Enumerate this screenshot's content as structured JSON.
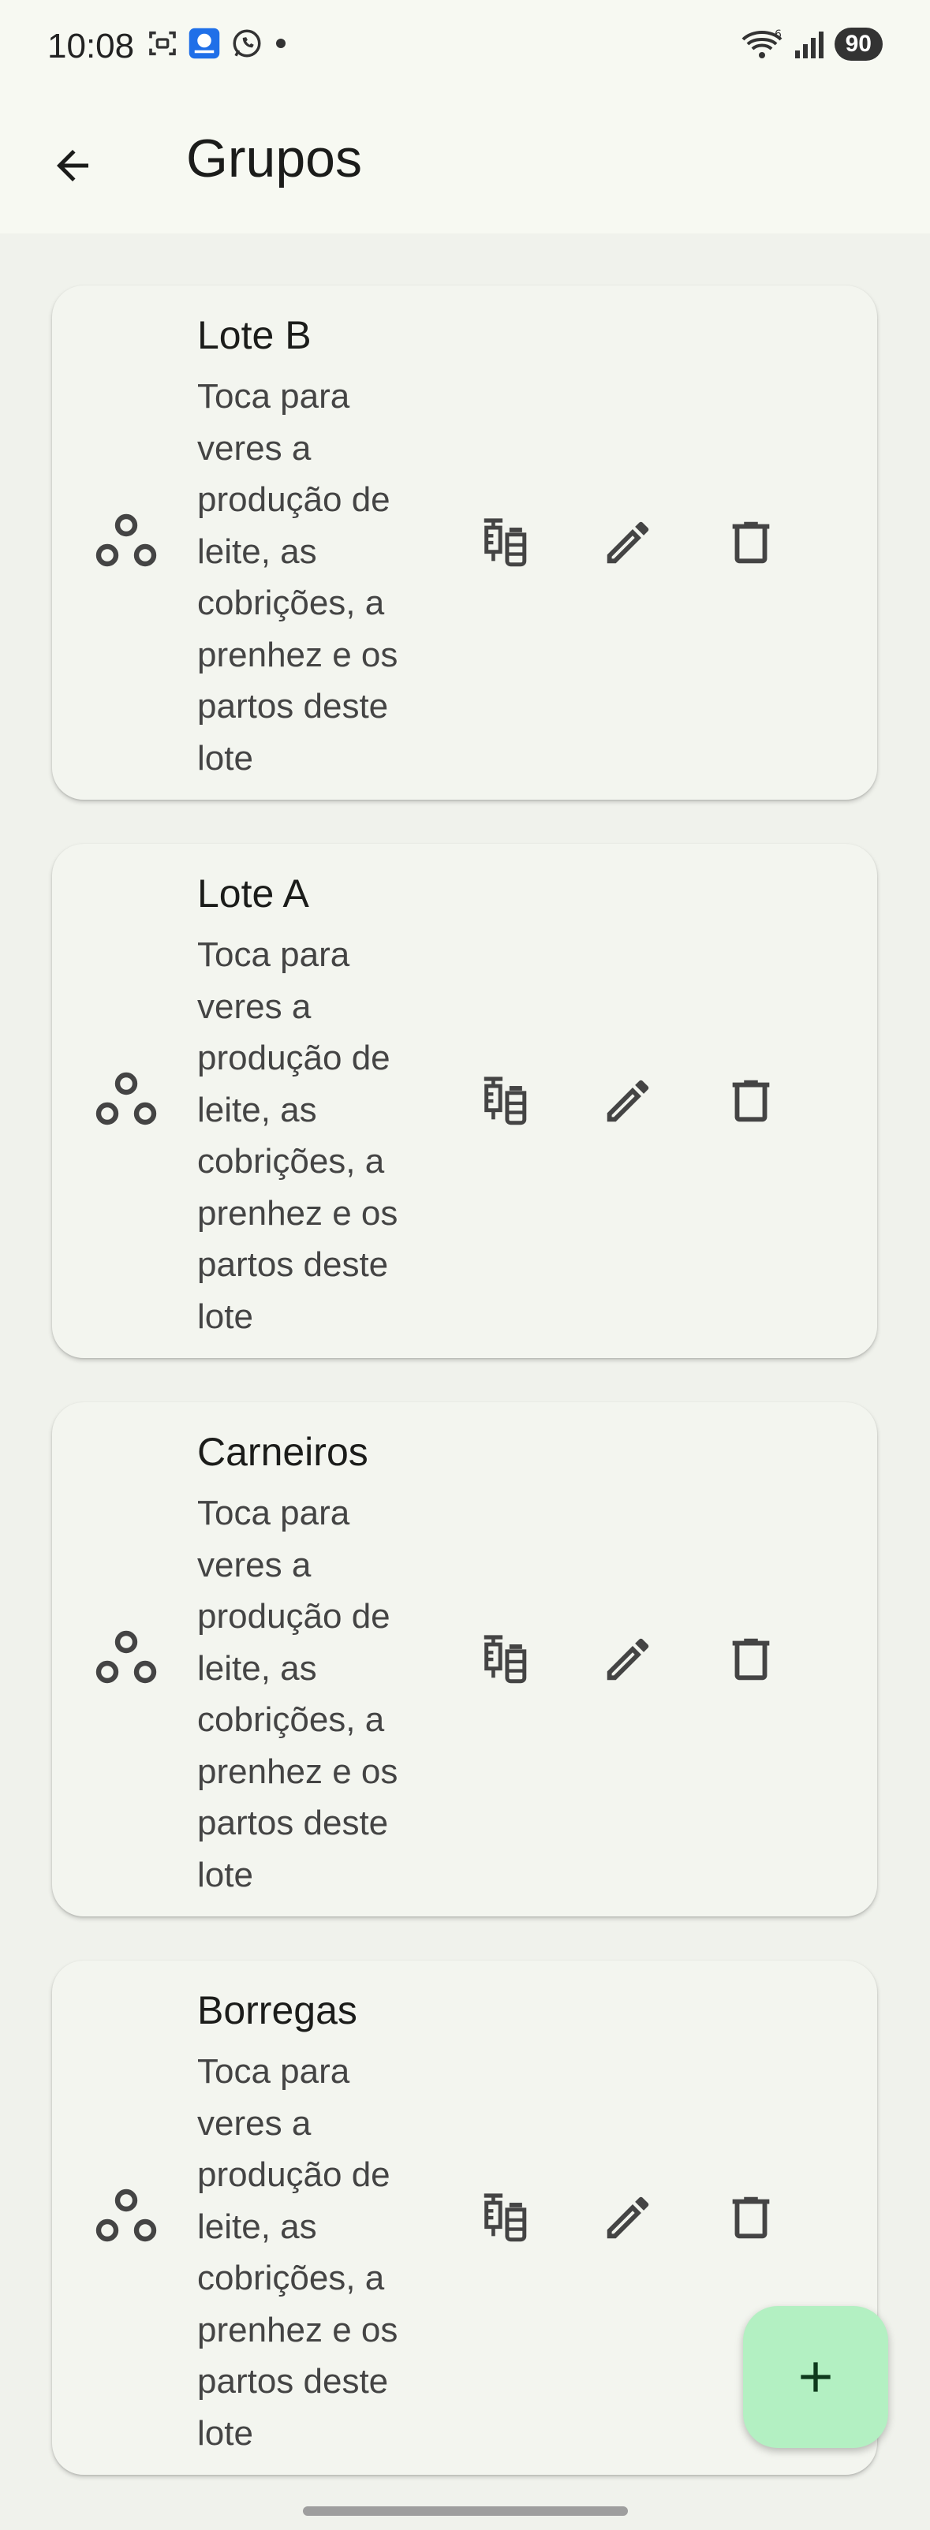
{
  "status_bar": {
    "time": "10:08",
    "battery": "90",
    "network": "6"
  },
  "app_bar": {
    "title": "Grupos"
  },
  "groups": [
    {
      "name": "Lote B",
      "description": "Toca para veres a produção de leite, as cobrições, a prenhez e os partos deste lote"
    },
    {
      "name": "Lote A",
      "description": "Toca para veres a produção de leite, as cobrições, a prenhez e os partos deste lote"
    },
    {
      "name": "Carneiros",
      "description": "Toca para veres a produção de leite, as cobrições, a prenhez e os partos deste lote"
    },
    {
      "name": "Borregas",
      "description": "Toca para veres a produção de leite, as cobrições, a prenhez e os partos deste lote"
    }
  ],
  "colors": {
    "background": "#f0f2ec",
    "card": "#f3f5ef",
    "fab": "#b3f0c2",
    "icon": "#444444"
  }
}
